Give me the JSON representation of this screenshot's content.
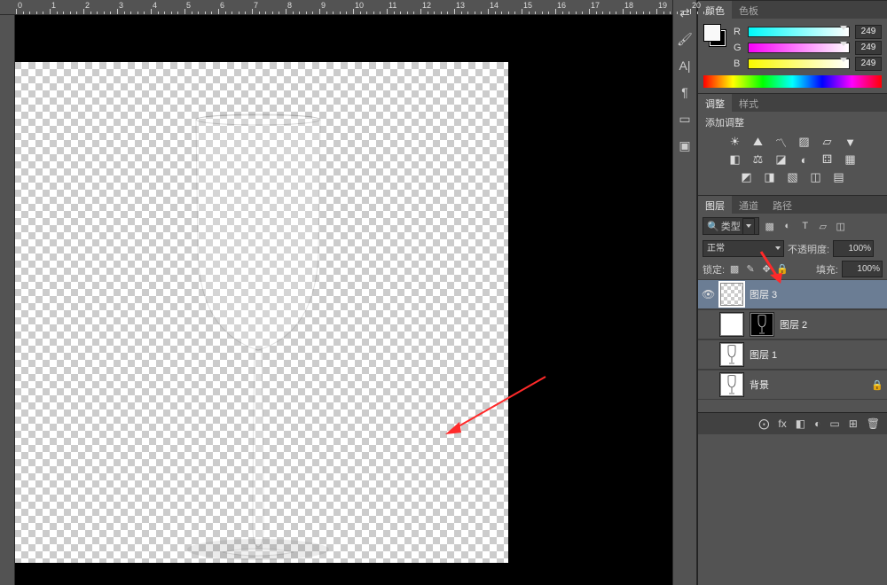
{
  "ruler_ticks": [
    0,
    1,
    2,
    3,
    4,
    5,
    6,
    7,
    8,
    9,
    10,
    11,
    12,
    13,
    14,
    15,
    16,
    17,
    18,
    19,
    20
  ],
  "color_panel": {
    "tab_color": "颜色",
    "tab_swatch": "色板",
    "r_label": "R",
    "r_value": "249",
    "g_label": "G",
    "g_value": "249",
    "b_label": "B",
    "b_value": "249"
  },
  "adjust_panel": {
    "tab_adjust": "调整",
    "tab_style": "样式",
    "add_label": "添加调整"
  },
  "layers_panel": {
    "tab_layers": "图层",
    "tab_channels": "通道",
    "tab_paths": "路径",
    "filter_label": "类型",
    "blend_mode": "正常",
    "opacity_label": "不透明度:",
    "opacity_value": "100%",
    "lock_label": "锁定:",
    "fill_label": "填充:",
    "fill_value": "100%",
    "layers": [
      {
        "name": "图层 3",
        "selected": true,
        "visible": true,
        "thumb": "chk",
        "mask": false
      },
      {
        "name": "图层 2",
        "selected": false,
        "visible": false,
        "thumb": "white",
        "mask": true
      },
      {
        "name": "图层 1",
        "selected": false,
        "visible": false,
        "thumb": "glass",
        "mask": false
      },
      {
        "name": "背景",
        "selected": false,
        "visible": false,
        "thumb": "glass",
        "mask": false,
        "locked": true
      }
    ]
  },
  "footer_icons": [
    "⨀",
    "fx",
    "◧",
    "◐",
    "▭",
    "⊞",
    "🗑"
  ]
}
